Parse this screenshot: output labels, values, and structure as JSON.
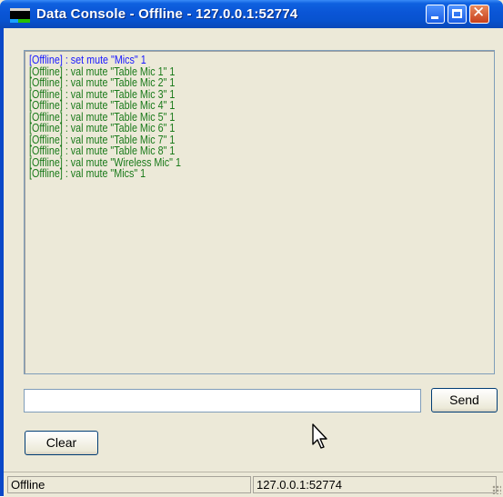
{
  "window": {
    "title": "Data Console - Offline - 127.0.0.1:52774"
  },
  "log": {
    "lines": [
      {
        "text": "[Offline] : set mute \"Mics\" 1",
        "color": "#1a1aff"
      },
      {
        "text": "[Offline] : val mute \"Table Mic 1\" 1",
        "color": "#1a7a1a"
      },
      {
        "text": "[Offline] : val mute \"Table Mic 2\" 1",
        "color": "#1a7a1a"
      },
      {
        "text": "[Offline] : val mute \"Table Mic 3\" 1",
        "color": "#1a7a1a"
      },
      {
        "text": "[Offline] : val mute \"Table Mic 4\" 1",
        "color": "#1a7a1a"
      },
      {
        "text": "[Offline] : val mute \"Table Mic 5\" 1",
        "color": "#1a7a1a"
      },
      {
        "text": "[Offline] : val mute \"Table Mic 6\" 1",
        "color": "#1a7a1a"
      },
      {
        "text": "[Offline] : val mute \"Table Mic 7\" 1",
        "color": "#1a7a1a"
      },
      {
        "text": "[Offline] : val mute \"Table Mic 8\" 1",
        "color": "#1a7a1a"
      },
      {
        "text": "[Offline] : val mute \"Wireless Mic\" 1",
        "color": "#1a7a1a"
      },
      {
        "text": "[Offline] : val mute \"Mics\" 1",
        "color": "#1a7a1a"
      }
    ]
  },
  "command": {
    "value": "",
    "send_label": "Send"
  },
  "clear_label": "Clear",
  "status": {
    "state": "Offline",
    "address": "127.0.0.1:52774"
  }
}
